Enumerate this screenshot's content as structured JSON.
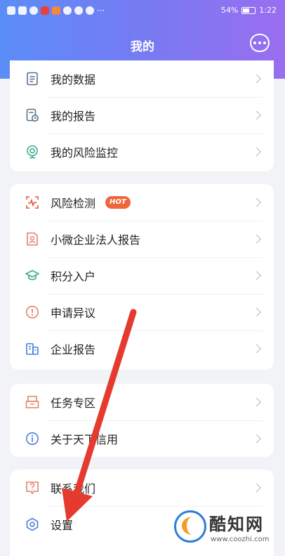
{
  "statusbar": {
    "signal_icons": "signal-icons",
    "battery": "54%",
    "time": "1:22"
  },
  "header": {
    "title": "我的",
    "chat_icon": "chat-bubble-icon"
  },
  "groups": [
    {
      "items": [
        {
          "label": "我的数据",
          "icon": "document-list-icon"
        },
        {
          "label": "我的报告",
          "icon": "report-clock-icon"
        },
        {
          "label": "我的风险监控",
          "icon": "camera-monitor-icon"
        }
      ]
    },
    {
      "items": [
        {
          "label": "风险检测",
          "icon": "risk-scan-icon",
          "badge": "HOT"
        },
        {
          "label": "小微企业法人报告",
          "icon": "person-card-icon"
        },
        {
          "label": "积分入户",
          "icon": "graduation-cap-icon"
        },
        {
          "label": "申请异议",
          "icon": "exclamation-circle-icon"
        },
        {
          "label": "企业报告",
          "icon": "building-report-icon"
        }
      ]
    },
    {
      "items": [
        {
          "label": "任务专区",
          "icon": "task-box-icon"
        },
        {
          "label": "关于天下信用",
          "icon": "info-circle-icon"
        }
      ]
    },
    {
      "items": [
        {
          "label": "联系我们",
          "icon": "question-box-icon"
        },
        {
          "label": "设置",
          "icon": "gear-hexagon-icon"
        }
      ]
    }
  ],
  "watermark": {
    "brand": "酷知网",
    "url": "www.coozhi.com"
  },
  "colors": {
    "accent": "#5b8df7",
    "icon_gray": "#5a7088",
    "hot_badge": "#f0663a",
    "overlay_arrow": "#e53b2f"
  }
}
